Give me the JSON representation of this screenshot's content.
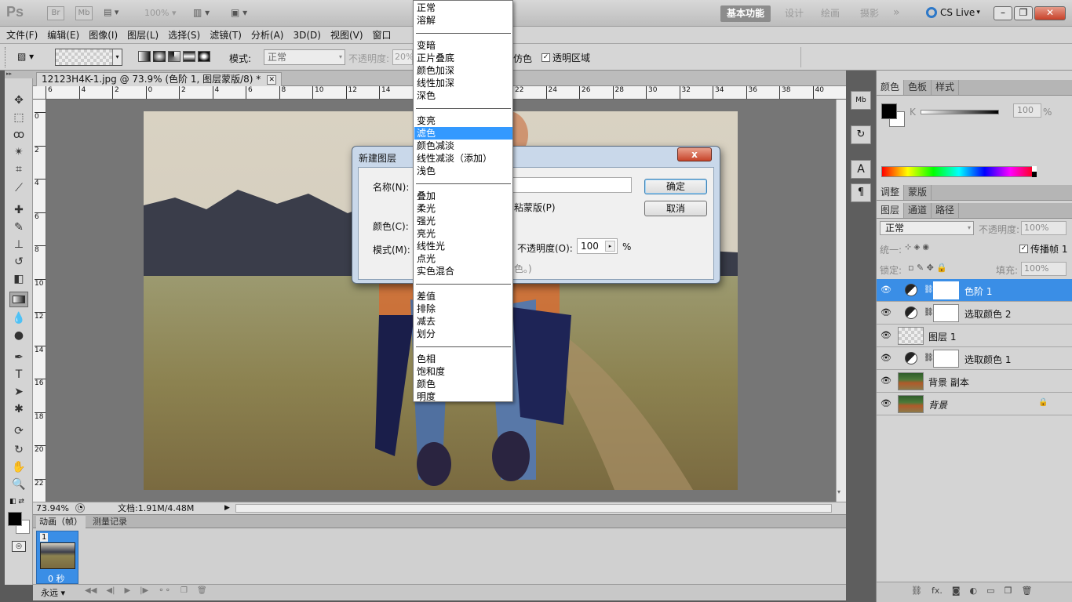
{
  "titlebar": {
    "app_logo": "Ps",
    "bridge": "Br",
    "mini_bridge": "Mb",
    "zoom": "100%",
    "workspaces": [
      "基本功能",
      "设计",
      "绘画",
      "摄影"
    ],
    "active_workspace": "基本功能",
    "cslive": "CS Live",
    "more": "»"
  },
  "menubar": [
    "文件(F)",
    "编辑(E)",
    "图像(I)",
    "图层(L)",
    "选择(S)",
    "滤镜(T)",
    "分析(A)",
    "3D(D)",
    "视图(V)",
    "窗口"
  ],
  "options": {
    "mode_label": "模式:",
    "mode_value": "正常",
    "opacity_label": "不透明度:",
    "opacity_value": "20%",
    "dither_tail": "仿色",
    "transparency": "透明区域"
  },
  "document": {
    "tab_title": "12123H4K-1.jpg @ 73.9% (色阶 1, 图层蒙版/8) *",
    "ruler_top": [
      "6",
      "4",
      "2",
      "0",
      "2",
      "4",
      "6",
      "8",
      "10",
      "12",
      "14",
      "16",
      "18",
      "20",
      "22",
      "24",
      "26",
      "28",
      "30",
      "32",
      "34",
      "36",
      "38",
      "40"
    ],
    "ruler_left": [
      "0",
      "2",
      "4",
      "6",
      "8",
      "10",
      "12",
      "14",
      "16",
      "18",
      "20",
      "22"
    ],
    "zoom": "73.94%",
    "doc_info": "文档:1.91M/4.48M"
  },
  "dialog": {
    "title": "新建图层",
    "name_label": "名称(N):",
    "color_label": "颜色(C):",
    "mode_label": "模式(M):",
    "clip_tail": "粘蒙版(P)",
    "opacity_label": "不透明度(O):",
    "opacity_value": "100",
    "percent": "%",
    "note_tail": "色。)",
    "ok": "确定",
    "cancel": "取消",
    "close": "x"
  },
  "blend_modes": {
    "groups": [
      [
        "正常",
        "溶解"
      ],
      [
        "变暗",
        "正片叠底",
        "颜色加深",
        "线性加深",
        "深色"
      ],
      [
        "变亮",
        "滤色",
        "颜色减淡",
        "线性减淡（添加）",
        "浅色"
      ],
      [
        "叠加",
        "柔光",
        "强光",
        "亮光",
        "线性光",
        "点光",
        "实色混合"
      ],
      [
        "差值",
        "排除",
        "减去",
        "划分"
      ],
      [
        "色相",
        "饱和度",
        "颜色",
        "明度"
      ]
    ],
    "highlighted": "滤色"
  },
  "animation": {
    "tabs": [
      "动画（帧）",
      "测量记录"
    ],
    "frame_number": "1",
    "frame_delay": "0 秒",
    "loop": "永远"
  },
  "panels": {
    "color_tabs": [
      "颜色",
      "色板",
      "样式"
    ],
    "k_label": "K",
    "k_value": "100",
    "k_unit": "%",
    "adj_tabs": [
      "调整",
      "蒙版"
    ],
    "layer_tabs": [
      "图层",
      "通道",
      "路径"
    ],
    "blend": "正常",
    "opacity_label": "不透明度:",
    "opacity_value": "100%",
    "unify_label": "统一:",
    "propagate": "传播帧 1",
    "lock_label": "锁定:",
    "fill_label": "填充:",
    "fill_value": "100%",
    "layers": [
      {
        "name": "色阶 1",
        "kind": "adjustment",
        "selected": true
      },
      {
        "name": "选取颜色 2",
        "kind": "adjustment",
        "selected": false
      },
      {
        "name": "图层 1",
        "kind": "transparent",
        "selected": false
      },
      {
        "name": "选取颜色 1",
        "kind": "adjustment",
        "selected": false
      },
      {
        "name": "背景 副本",
        "kind": "photo",
        "selected": false
      },
      {
        "name": "背景",
        "kind": "photo-locked",
        "selected": false
      }
    ],
    "bottom_icons": [
      "link-icon",
      "fx-icon",
      "mask-icon",
      "adjustment-icon",
      "group-icon",
      "new-layer-icon",
      "trash-icon"
    ],
    "fx": "fx."
  },
  "colors": {
    "selection_blue": "#3a8ee6",
    "menu_highlight": "#3399ff",
    "panel_gray": "#d4d4d4"
  }
}
